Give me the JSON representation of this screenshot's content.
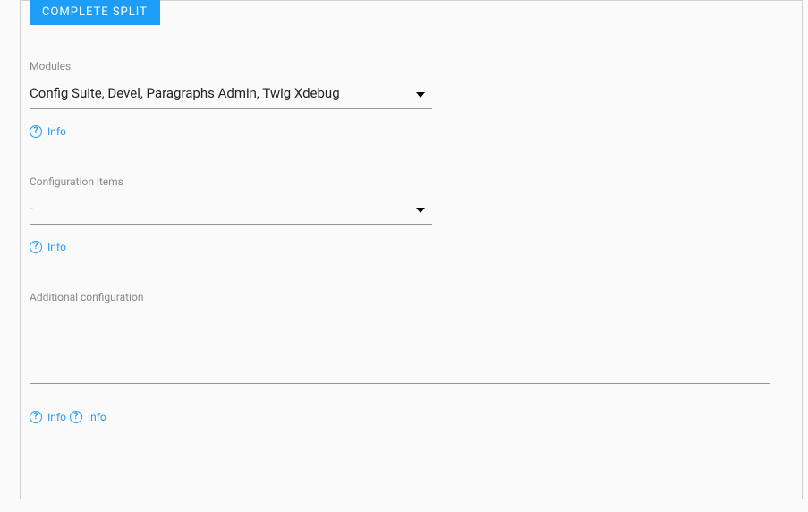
{
  "legend": "COMPLETE SPLIT",
  "fields": {
    "modules": {
      "label": "Modules",
      "value": "Config Suite, Devel, Paragraphs Admin, Twig Xdebug",
      "info": "Info"
    },
    "configItems": {
      "label": "Configuration items",
      "value": "-",
      "info": "Info"
    },
    "additional": {
      "label": "Additional configuration",
      "value": "",
      "info": "Info"
    }
  },
  "extraInfo": "Info"
}
